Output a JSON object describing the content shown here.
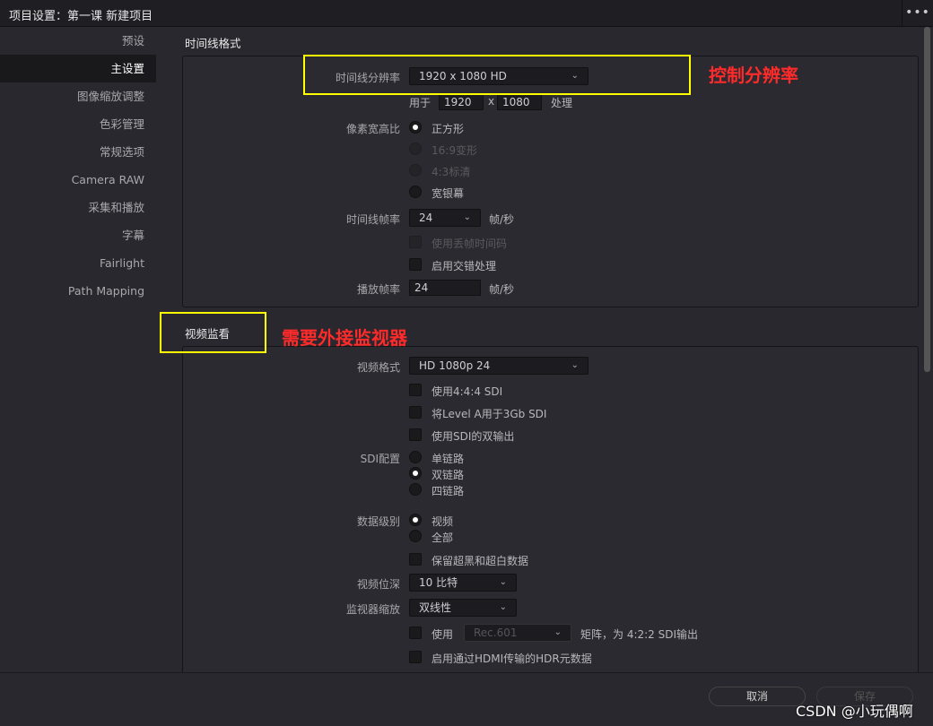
{
  "window": {
    "title": "项目设置：第一课 新建项目",
    "menu": "•••"
  },
  "sidebar": {
    "items": [
      {
        "label": "预设"
      },
      {
        "label": "主设置",
        "selected": true
      },
      {
        "label": "图像缩放调整"
      },
      {
        "label": "色彩管理"
      },
      {
        "label": "常规选项"
      },
      {
        "label": "Camera RAW"
      },
      {
        "label": "采集和播放"
      },
      {
        "label": "字幕"
      },
      {
        "label": "Fairlight"
      },
      {
        "label": "Path Mapping"
      }
    ]
  },
  "timeline": {
    "header": "时间线格式",
    "resolution_label": "时间线分辨率",
    "resolution": "1920 x 1080 HD",
    "for_label": "用于",
    "width": "1920",
    "x": "x",
    "height": "1080",
    "process": "处理",
    "par_label": "像素宽高比",
    "par": [
      "正方形",
      "16:9变形",
      "4:3标清",
      "宽银幕"
    ],
    "fps_label": "时间线帧率",
    "fps": "24",
    "fps_unit": "帧/秒",
    "dropframe": "使用丢帧时间码",
    "interlace": "启用交错处理",
    "play_label": "播放帧率",
    "play_fps": "24",
    "play_unit": "帧/秒"
  },
  "monitor": {
    "header": "视频监看",
    "format_label": "视频格式",
    "format": "HD 1080p 24",
    "c444": "使用4:4:4 SDI",
    "levelA": "将Level A用于3Gb SDI",
    "dual": "使用SDI的双输出",
    "sdi_label": "SDI配置",
    "sdi": [
      "单链路",
      "双链路",
      "四链路"
    ],
    "level_label": "数据级别",
    "levels": [
      "视频",
      "全部"
    ],
    "retain": "保留超黑和超白数据",
    "depth_label": "视频位深",
    "depth": "10 比特",
    "scale_label": "监视器缩放",
    "scale": "双线性",
    "use": "使用",
    "matrix": "Rec.601",
    "matrix_suffix": "矩阵，为 4:2:2 SDI输出",
    "hdr": "启用通过HDMI传输的HDR元数据"
  },
  "footer": {
    "cancel": "取消",
    "save": "保存"
  },
  "annotations": {
    "a1": "控制分辨率",
    "a2": "需要外接监视器",
    "color_box": "#ffff00",
    "color_text": "#ff2a2a"
  },
  "watermark": "CSDN @小玩偶啊"
}
